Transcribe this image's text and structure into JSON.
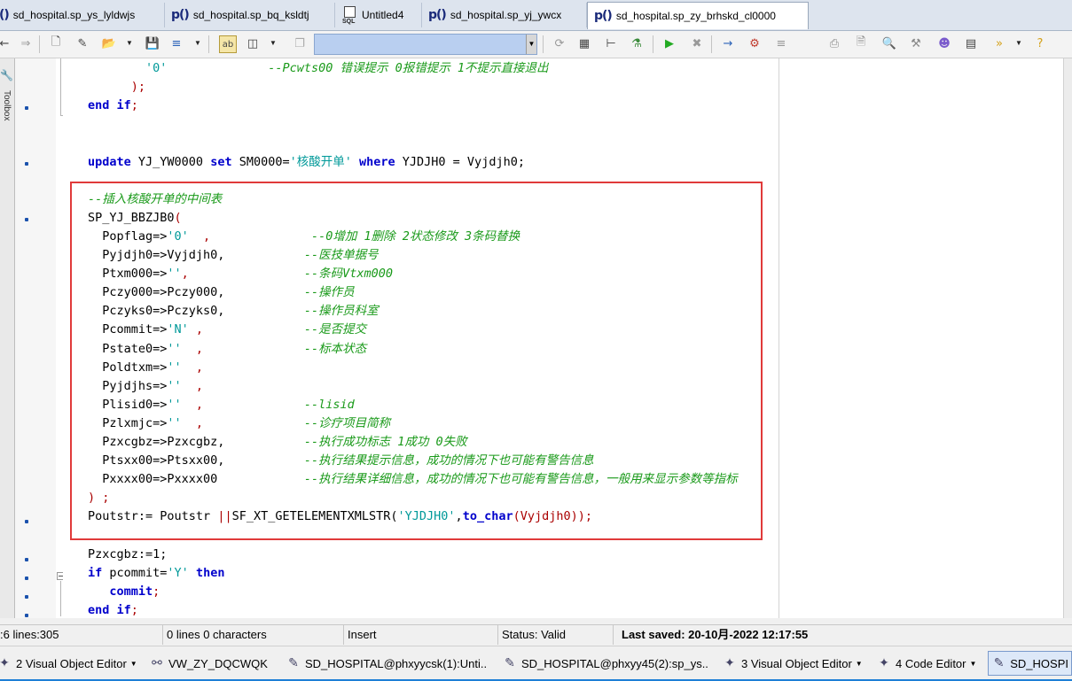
{
  "tabs": [
    {
      "icon": "()",
      "label": "sd_hospital.sp_ys_lyldwjs"
    },
    {
      "icon": "p()",
      "label": "sd_hospital.sp_bq_ksldtj"
    },
    {
      "icon": "SQL",
      "label": "Untitled4"
    },
    {
      "icon": "p()",
      "label": "sd_hospital.sp_yj_ywcx"
    },
    {
      "icon": "p()",
      "label": "sd_hospital.sp_zy_brhskd_cl0000"
    }
  ],
  "toolbar": {
    "icons": [
      "back-icon",
      "forward-icon",
      "new-file-icon",
      "open-wizard-icon",
      "open-folder-icon",
      "save-icon",
      "save-all-icon",
      "toggle-ab-icon",
      "split-panel-icon",
      "copy-icon",
      "sql-icon",
      "tree-icon",
      "network-icon",
      "run-icon",
      "stop-icon",
      "step-icon",
      "debug-icon",
      "list-icon",
      "print-icon",
      "preview-icon",
      "find-icon",
      "tools-icon",
      "user-icon",
      "layout-icon",
      "more-icon",
      "help-icon"
    ]
  },
  "left_strip_label": "Toolbox",
  "code_lines": [
    [
      {
        "t": "        ",
        "c": ""
      },
      {
        "t": "'0'",
        "c": "str"
      },
      {
        "t": "              ",
        "c": ""
      },
      {
        "t": "--Pcwts00 错误提示 0报错提示 1不提示直接退出",
        "c": "cmt"
      }
    ],
    [
      {
        "t": "      ",
        "c": ""
      },
      {
        "t": ");",
        "c": "op"
      }
    ],
    [
      {
        "t": "end if",
        "c": "kw"
      },
      {
        "t": ";",
        "c": "op"
      }
    ],
    [
      {
        "t": "",
        "c": ""
      }
    ],
    [
      {
        "t": "",
        "c": ""
      }
    ],
    [
      {
        "t": "update",
        "c": "kw"
      },
      {
        "t": " YJ_YW0000 ",
        "c": ""
      },
      {
        "t": "set",
        "c": "kw"
      },
      {
        "t": " SM0000=",
        "c": ""
      },
      {
        "t": "'核酸开单'",
        "c": "str"
      },
      {
        "t": " ",
        "c": ""
      },
      {
        "t": "where",
        "c": "kw"
      },
      {
        "t": " YJDJH0 = Vyjdjh0;",
        "c": ""
      }
    ],
    [
      {
        "t": "",
        "c": ""
      }
    ],
    [
      {
        "t": "--插入核酸开单的中间表",
        "c": "cmt"
      }
    ],
    [
      {
        "t": "SP_YJ_BBZJB0",
        "c": ""
      },
      {
        "t": "(",
        "c": "op"
      }
    ],
    [
      {
        "t": "  Popflag=>",
        "c": ""
      },
      {
        "t": "'0'",
        "c": "str"
      },
      {
        "t": "  ,",
        "c": "op"
      },
      {
        "t": "              ",
        "c": ""
      },
      {
        "t": "--0增加 1删除 2状态修改 3条码替换",
        "c": "cmt"
      }
    ],
    [
      {
        "t": "  Pyjdjh0=>Vyjdjh0,",
        "c": ""
      },
      {
        "t": "           ",
        "c": ""
      },
      {
        "t": "--医技单据号",
        "c": "cmt"
      }
    ],
    [
      {
        "t": "  Ptxm000=>",
        "c": ""
      },
      {
        "t": "''",
        "c": "str"
      },
      {
        "t": ",",
        "c": "op"
      },
      {
        "t": "                ",
        "c": ""
      },
      {
        "t": "--条码Vtxm000",
        "c": "cmt"
      }
    ],
    [
      {
        "t": "  Pczy000=>Pczy000,",
        "c": ""
      },
      {
        "t": "           ",
        "c": ""
      },
      {
        "t": "--操作员",
        "c": "cmt"
      }
    ],
    [
      {
        "t": "  Pczyks0=>Pczyks0,",
        "c": ""
      },
      {
        "t": "           ",
        "c": ""
      },
      {
        "t": "--操作员科室",
        "c": "cmt"
      }
    ],
    [
      {
        "t": "  Pcommit=>",
        "c": ""
      },
      {
        "t": "'N'",
        "c": "str"
      },
      {
        "t": " ,",
        "c": "op"
      },
      {
        "t": "              ",
        "c": ""
      },
      {
        "t": "--是否提交",
        "c": "cmt"
      }
    ],
    [
      {
        "t": "  Pstate0=>",
        "c": ""
      },
      {
        "t": "''",
        "c": "str"
      },
      {
        "t": "  ,",
        "c": "op"
      },
      {
        "t": "              ",
        "c": ""
      },
      {
        "t": "--标本状态",
        "c": "cmt"
      }
    ],
    [
      {
        "t": "  Poldtxm=>",
        "c": ""
      },
      {
        "t": "''",
        "c": "str"
      },
      {
        "t": "  ,",
        "c": "op"
      }
    ],
    [
      {
        "t": "  Pyjdjhs=>",
        "c": ""
      },
      {
        "t": "''",
        "c": "str"
      },
      {
        "t": "  ,",
        "c": "op"
      }
    ],
    [
      {
        "t": "  Plisid0=>",
        "c": ""
      },
      {
        "t": "''",
        "c": "str"
      },
      {
        "t": "  ,",
        "c": "op"
      },
      {
        "t": "              ",
        "c": ""
      },
      {
        "t": "--lisid",
        "c": "cmt"
      }
    ],
    [
      {
        "t": "  Pzlxmjc=>",
        "c": ""
      },
      {
        "t": "''",
        "c": "str"
      },
      {
        "t": "  ,",
        "c": "op"
      },
      {
        "t": "              ",
        "c": ""
      },
      {
        "t": "--诊疗项目简称",
        "c": "cmt"
      }
    ],
    [
      {
        "t": "  Pzxcgbz=>Pzxcgbz,",
        "c": ""
      },
      {
        "t": "           ",
        "c": ""
      },
      {
        "t": "--执行成功标志 1成功 0失败",
        "c": "cmt"
      }
    ],
    [
      {
        "t": "  Ptsxx00=>Ptsxx00,",
        "c": ""
      },
      {
        "t": "           ",
        "c": ""
      },
      {
        "t": "--执行结果提示信息，成功的情况下也可能有警告信息",
        "c": "cmt"
      }
    ],
    [
      {
        "t": "  Pxxxx00=>Pxxxx00",
        "c": ""
      },
      {
        "t": "            ",
        "c": ""
      },
      {
        "t": "--执行结果详细信息，成功的情况下也可能有警告信息，一般用来显示参数等指标",
        "c": "cmt"
      }
    ],
    [
      {
        "t": ") ;",
        "c": "op"
      }
    ],
    [
      {
        "t": "Poutstr:= Poutstr ",
        "c": ""
      },
      {
        "t": "||",
        "c": "op"
      },
      {
        "t": "SF_XT_GETELEMENTXMLSTR(",
        "c": ""
      },
      {
        "t": "'YJDJH0'",
        "c": "str"
      },
      {
        "t": ",",
        "c": ""
      },
      {
        "t": "to_char",
        "c": "kw"
      },
      {
        "t": "(Vyjdjh0));",
        "c": "op"
      }
    ],
    [
      {
        "t": "",
        "c": ""
      }
    ],
    [
      {
        "t": "Pzxcgbz:=1;",
        "c": ""
      }
    ],
    [
      {
        "t": "if",
        "c": "kw"
      },
      {
        "t": " pcommit=",
        "c": ""
      },
      {
        "t": "'Y'",
        "c": "str"
      },
      {
        "t": " ",
        "c": ""
      },
      {
        "t": "then",
        "c": "kw"
      }
    ],
    [
      {
        "t": "   commit",
        "c": "kw"
      },
      {
        "t": ";",
        "c": "op"
      }
    ],
    [
      {
        "t": "end if",
        "c": "kw"
      },
      {
        "t": ";",
        "c": "op"
      }
    ]
  ],
  "status": {
    "position": ":6 lines:305",
    "selection": "0 lines 0 characters",
    "mode": "Insert",
    "validity": "Status: Valid",
    "saved": "Last saved: 20-10月-2022 12:17:55"
  },
  "taskbar": [
    {
      "icon": "wizard-icon",
      "label": "2 Visual Object Editor",
      "dropdown": true
    },
    {
      "icon": "glasses-icon",
      "label": "VW_ZY_DQCWQK",
      "dropdown": false
    },
    {
      "icon": "edit-icon",
      "label": "SD_HOSPITAL@phxyycsk(1):Unti..",
      "dropdown": false
    },
    {
      "icon": "edit-icon",
      "label": "SD_HOSPITAL@phxyy45(2):sp_ys..",
      "dropdown": false
    },
    {
      "icon": "wizard-icon",
      "label": "3 Visual Object Editor",
      "dropdown": true
    },
    {
      "icon": "wizard-icon",
      "label": "4 Code Editor",
      "dropdown": true
    },
    {
      "icon": "edit-icon",
      "label": "SD_HOSPI",
      "dropdown": false
    }
  ],
  "colors": {
    "highlight_box": "#e03a3a",
    "keyword": "#0000cc",
    "string": "#009999",
    "comment": "#1a9a1a",
    "operator": "#aa0000"
  }
}
